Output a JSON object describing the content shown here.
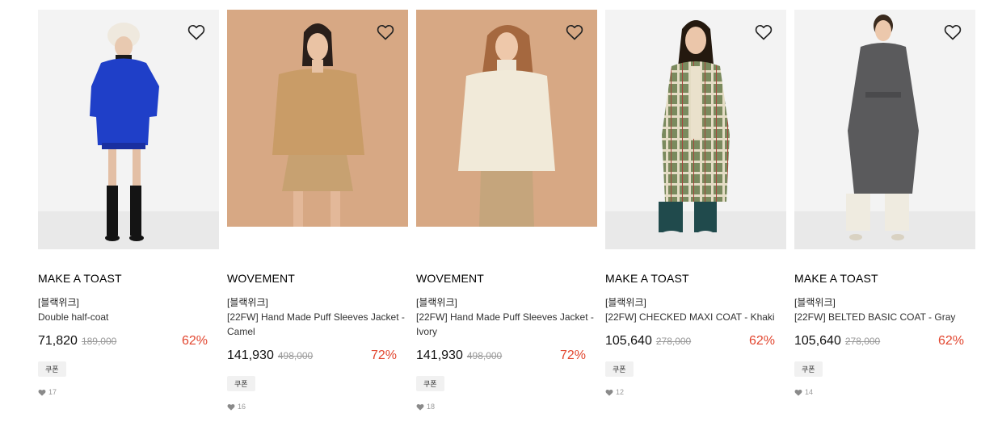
{
  "products": [
    {
      "brand": "MAKE A TOAST",
      "tag": "[블랙위크]",
      "name": "Double half-coat",
      "price": "71,820",
      "original_price": "189,000",
      "discount": "62%",
      "coupon": "쿠폰",
      "likes": "17"
    },
    {
      "brand": "WOVEMENT",
      "tag": "[블랙위크]",
      "name": "[22FW] Hand Made Puff Sleeves Jacket - Camel",
      "price": "141,930",
      "original_price": "498,000",
      "discount": "72%",
      "coupon": "쿠폰",
      "likes": "16"
    },
    {
      "brand": "WOVEMENT",
      "tag": "[블랙위크]",
      "name": "[22FW] Hand Made Puff Sleeves Jacket - Ivory",
      "price": "141,930",
      "original_price": "498,000",
      "discount": "72%",
      "coupon": "쿠폰",
      "likes": "18"
    },
    {
      "brand": "MAKE A TOAST",
      "tag": "[블랙위크]",
      "name": "[22FW] CHECKED MAXI COAT - Khaki",
      "price": "105,640",
      "original_price": "278,000",
      "discount": "62%",
      "coupon": "쿠폰",
      "likes": "12"
    },
    {
      "brand": "MAKE A TOAST",
      "tag": "[블랙위크]",
      "name": "[22FW] BELTED BASIC COAT - Gray",
      "price": "105,640",
      "original_price": "278,000",
      "discount": "62%",
      "coupon": "쿠폰",
      "likes": "14"
    }
  ],
  "colors": {
    "discount": "#e2462f",
    "camel_bg": "#d7a884",
    "studio_bg": "#f2f2f2"
  },
  "icons": {
    "wishlist": "heart-outline-icon",
    "likes": "heart-filled-icon"
  }
}
